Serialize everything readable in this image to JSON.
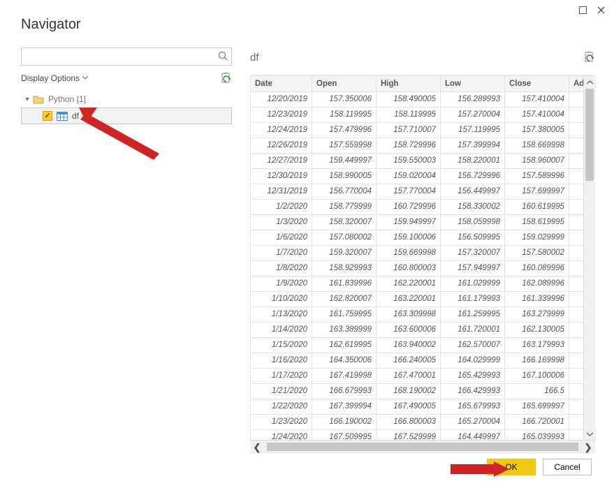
{
  "window": {
    "title": "Navigator"
  },
  "search": {
    "placeholder": ""
  },
  "display_options": {
    "label": "Display Options"
  },
  "tree": {
    "root": {
      "label": "Python [1]"
    },
    "children": [
      {
        "label": "df",
        "checked": true,
        "selected": true
      }
    ]
  },
  "preview": {
    "title": "df"
  },
  "columns": [
    "Date",
    "Open",
    "High",
    "Low",
    "Close",
    "Adj Close"
  ],
  "rows": [
    {
      "date": "12/20/2019",
      "open": "157.350006",
      "high": "158.490005",
      "low": "156.289993",
      "close": "157.410004"
    },
    {
      "date": "12/23/2019",
      "open": "158.119995",
      "high": "158.119995",
      "low": "157.270004",
      "close": "157.410004"
    },
    {
      "date": "12/24/2019",
      "open": "157.479996",
      "high": "157.710007",
      "low": "157.119995",
      "close": "157.380005"
    },
    {
      "date": "12/26/2019",
      "open": "157.559998",
      "high": "158.729996",
      "low": "157.399994",
      "close": "158.669998"
    },
    {
      "date": "12/27/2019",
      "open": "159.449997",
      "high": "159.550003",
      "low": "158.220001",
      "close": "158.960007"
    },
    {
      "date": "12/30/2019",
      "open": "158.990005",
      "high": "159.020004",
      "low": "156.729996",
      "close": "157.589996"
    },
    {
      "date": "12/31/2019",
      "open": "156.770004",
      "high": "157.770004",
      "low": "156.449997",
      "close": "157.699997"
    },
    {
      "date": "1/2/2020",
      "open": "158.779999",
      "high": "160.729996",
      "low": "158.330002",
      "close": "160.619995"
    },
    {
      "date": "1/3/2020",
      "open": "158.320007",
      "high": "159.949997",
      "low": "158.059998",
      "close": "158.619995"
    },
    {
      "date": "1/6/2020",
      "open": "157.080002",
      "high": "159.100006",
      "low": "156.509995",
      "close": "159.029999"
    },
    {
      "date": "1/7/2020",
      "open": "159.320007",
      "high": "159.669998",
      "low": "157.320007",
      "close": "157.580002"
    },
    {
      "date": "1/8/2020",
      "open": "158.929993",
      "high": "160.800003",
      "low": "157.949997",
      "close": "160.089996"
    },
    {
      "date": "1/9/2020",
      "open": "161.839996",
      "high": "162.220001",
      "low": "161.029999",
      "close": "162.089996"
    },
    {
      "date": "1/10/2020",
      "open": "162.820007",
      "high": "163.220001",
      "low": "161.179993",
      "close": "161.339996"
    },
    {
      "date": "1/13/2020",
      "open": "161.759995",
      "high": "163.309998",
      "low": "161.259995",
      "close": "163.279999"
    },
    {
      "date": "1/14/2020",
      "open": "163.389999",
      "high": "163.600006",
      "low": "161.720001",
      "close": "162.130005"
    },
    {
      "date": "1/15/2020",
      "open": "162.619995",
      "high": "163.940002",
      "low": "162.570007",
      "close": "163.179993"
    },
    {
      "date": "1/16/2020",
      "open": "164.350006",
      "high": "166.240005",
      "low": "164.029999",
      "close": "166.169998"
    },
    {
      "date": "1/17/2020",
      "open": "167.419998",
      "high": "167.470001",
      "low": "165.429993",
      "close": "167.100006"
    },
    {
      "date": "1/21/2020",
      "open": "166.679993",
      "high": "168.190002",
      "low": "166.429993",
      "close": "166.5"
    },
    {
      "date": "1/22/2020",
      "open": "167.399994",
      "high": "167.490005",
      "low": "165.679993",
      "close": "165.699997"
    },
    {
      "date": "1/23/2020",
      "open": "166.190002",
      "high": "166.800003",
      "low": "165.270004",
      "close": "166.720001"
    },
    {
      "date": "1/24/2020",
      "open": "167.509995",
      "high": "167.529999",
      "low": "164.449997",
      "close": "165.039993"
    }
  ],
  "buttons": {
    "ok": "OK",
    "cancel": "Cancel"
  }
}
